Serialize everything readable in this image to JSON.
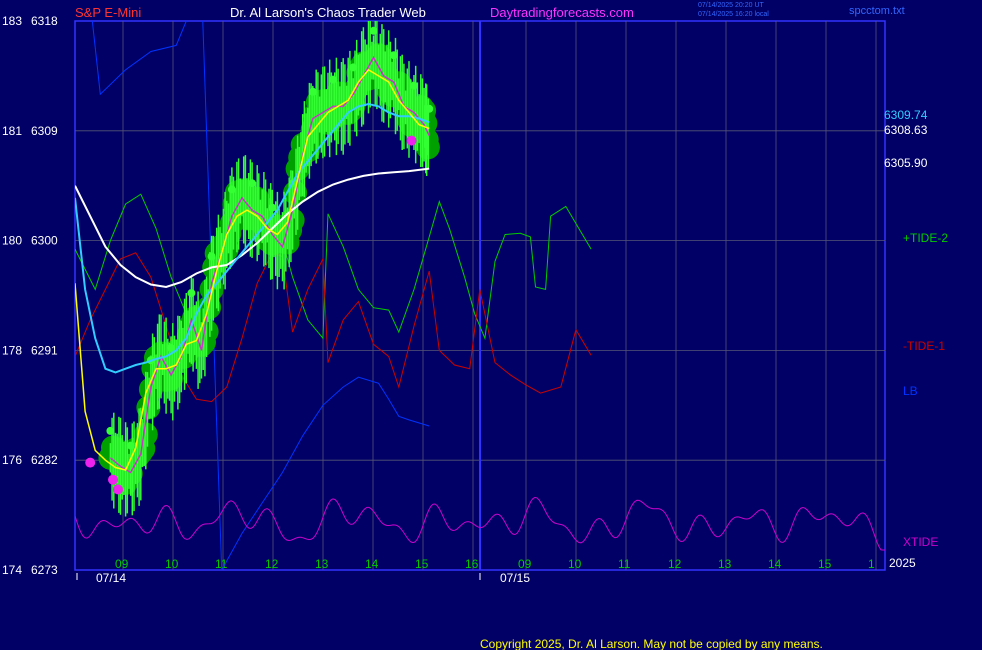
{
  "header": {
    "instrument": "S&P E-Mini",
    "title": "Dr. Al Larson's Chaos Trader Web",
    "site": "Daytradingforecasts.com",
    "timestamp_utc": "07/14/2025 20:20 UT",
    "timestamp_local": "07/14/2025 16:20 local",
    "file": "spcctom.txt"
  },
  "colors": {
    "background": "#000066",
    "plot_border": "#3333ff",
    "grid": "#555577",
    "price_hl": "#00e000",
    "halo": "#00a000",
    "price_close": "#cc33cc",
    "ma_fast": "#ffff00",
    "ma_mid": "#33ccff",
    "ma_slow": "#ffffff",
    "tide_plus": "#00cc00",
    "tide_minus": "#cc0000",
    "lb": "#0033ff",
    "xtide": "#cc00cc",
    "hour_label": "#00cc00",
    "date_label": "#ffffff"
  },
  "chart_data": {
    "type": "line",
    "y_axis": {
      "ticks": [
        {
          "left": "183",
          "price": "6318",
          "value": 6318
        },
        {
          "left": "181",
          "price": "6309",
          "value": 6309
        },
        {
          "left": "180",
          "price": "6300",
          "value": 6300
        },
        {
          "left": "178",
          "price": "6291",
          "value": 6291
        },
        {
          "left": "176",
          "price": "6282",
          "value": 6282
        },
        {
          "left": "174",
          "price": "6273",
          "value": 6273
        }
      ],
      "ylim": [
        6273,
        6318
      ]
    },
    "x_axis": {
      "hour_labels_day1": [
        "09",
        "10",
        "11",
        "12",
        "13",
        "14",
        "15",
        "16"
      ],
      "hour_labels_day2": [
        "09",
        "10",
        "11",
        "12",
        "13",
        "14",
        "15",
        "1"
      ],
      "dates": [
        "07/14",
        "07/15"
      ],
      "year_label": "2025"
    },
    "price_labels": [
      "6309.74",
      "6308.63",
      "6305.90"
    ],
    "series_labels": [
      "+TIDE-2",
      "-TIDE-1",
      "LB",
      "XTIDE"
    ],
    "close": [
      [
        8.7,
        6282.2
      ],
      [
        8.9,
        6281.5
      ],
      [
        9.1,
        6281.0
      ],
      [
        9.3,
        6282.5
      ],
      [
        9.5,
        6288.0
      ],
      [
        9.7,
        6290.5
      ],
      [
        9.9,
        6289.0
      ],
      [
        10.1,
        6290.5
      ],
      [
        10.3,
        6293.5
      ],
      [
        10.5,
        6291.0
      ],
      [
        10.7,
        6296.5
      ],
      [
        10.9,
        6299.0
      ],
      [
        11.1,
        6302.0
      ],
      [
        11.3,
        6303.5
      ],
      [
        11.5,
        6302.5
      ],
      [
        11.7,
        6302.0
      ],
      [
        11.9,
        6300.5
      ],
      [
        12.1,
        6299.5
      ],
      [
        12.3,
        6302.5
      ],
      [
        12.5,
        6307.0
      ],
      [
        12.7,
        6310.0
      ],
      [
        12.9,
        6310.5
      ],
      [
        13.1,
        6311.0
      ],
      [
        13.3,
        6311.0
      ],
      [
        13.5,
        6312.0
      ],
      [
        13.7,
        6313.5
      ],
      [
        13.9,
        6315.0
      ],
      [
        14.1,
        6313.5
      ],
      [
        14.3,
        6313.0
      ],
      [
        14.5,
        6311.0
      ],
      [
        14.7,
        6310.5
      ],
      [
        14.9,
        6309.5
      ],
      [
        15.0,
        6308.6
      ]
    ],
    "ma_fast": [
      [
        8.0,
        6296.5
      ],
      [
        8.2,
        6286.0
      ],
      [
        8.4,
        6282.8
      ],
      [
        8.6,
        6282.0
      ],
      [
        8.8,
        6281.4
      ],
      [
        9.0,
        6281.2
      ],
      [
        9.2,
        6283.0
      ],
      [
        9.4,
        6287.5
      ],
      [
        9.6,
        6289.5
      ],
      [
        9.8,
        6289.5
      ],
      [
        10.0,
        6289.8
      ],
      [
        10.2,
        6291.5
      ],
      [
        10.4,
        6291.8
      ],
      [
        10.6,
        6294.0
      ],
      [
        10.8,
        6297.5
      ],
      [
        11.0,
        6300.5
      ],
      [
        11.2,
        6302.0
      ],
      [
        11.4,
        6302.5
      ],
      [
        11.6,
        6302.0
      ],
      [
        11.8,
        6301.0
      ],
      [
        12.0,
        6300.5
      ],
      [
        12.2,
        6301.5
      ],
      [
        12.4,
        6305.0
      ],
      [
        12.6,
        6308.5
      ],
      [
        12.8,
        6309.5
      ],
      [
        13.0,
        6310.5
      ],
      [
        13.2,
        6311.0
      ],
      [
        13.4,
        6311.5
      ],
      [
        13.6,
        6313.0
      ],
      [
        13.8,
        6314.0
      ],
      [
        14.0,
        6313.5
      ],
      [
        14.2,
        6313.0
      ],
      [
        14.4,
        6311.5
      ],
      [
        14.6,
        6310.5
      ],
      [
        14.8,
        6309.5
      ],
      [
        15.0,
        6309.2
      ]
    ],
    "ma_mid": [
      [
        8.0,
        6303.5
      ],
      [
        8.2,
        6296.0
      ],
      [
        8.4,
        6292.0
      ],
      [
        8.6,
        6289.5
      ],
      [
        8.8,
        6289.2
      ],
      [
        9.0,
        6289.5
      ],
      [
        9.2,
        6289.8
      ],
      [
        9.4,
        6290.0
      ],
      [
        9.6,
        6290.3
      ],
      [
        9.8,
        6290.5
      ],
      [
        10.0,
        6291.0
      ],
      [
        10.2,
        6292.0
      ],
      [
        10.4,
        6294.0
      ],
      [
        10.6,
        6295.5
      ],
      [
        10.8,
        6296.5
      ],
      [
        11.0,
        6297.5
      ],
      [
        11.2,
        6298.5
      ],
      [
        11.4,
        6299.5
      ],
      [
        11.6,
        6300.5
      ],
      [
        11.8,
        6301.5
      ],
      [
        12.0,
        6302.5
      ],
      [
        12.2,
        6304.0
      ],
      [
        12.4,
        6305.5
      ],
      [
        12.6,
        6306.5
      ],
      [
        12.8,
        6307.5
      ],
      [
        13.0,
        6308.5
      ],
      [
        13.2,
        6309.5
      ],
      [
        13.4,
        6310.5
      ],
      [
        13.6,
        6311.0
      ],
      [
        13.8,
        6311.2
      ],
      [
        14.0,
        6311.0
      ],
      [
        14.2,
        6310.5
      ],
      [
        14.4,
        6310.2
      ],
      [
        14.6,
        6310.2
      ],
      [
        14.8,
        6310.0
      ],
      [
        15.0,
        6309.7
      ]
    ],
    "ma_slow": [
      [
        8.0,
        6304.5
      ],
      [
        8.3,
        6302.0
      ],
      [
        8.6,
        6299.5
      ],
      [
        8.9,
        6298.0
      ],
      [
        9.2,
        6297.0
      ],
      [
        9.5,
        6296.4
      ],
      [
        9.8,
        6296.2
      ],
      [
        10.1,
        6296.6
      ],
      [
        10.4,
        6297.3
      ],
      [
        10.7,
        6297.8
      ],
      [
        11.0,
        6298.0
      ],
      [
        11.3,
        6298.8
      ],
      [
        11.6,
        6299.8
      ],
      [
        11.9,
        6301.0
      ],
      [
        12.2,
        6302.2
      ],
      [
        12.5,
        6303.2
      ],
      [
        12.8,
        6304.0
      ],
      [
        13.1,
        6304.6
      ],
      [
        13.4,
        6305.0
      ],
      [
        13.7,
        6305.3
      ],
      [
        14.0,
        6305.5
      ],
      [
        14.3,
        6305.6
      ],
      [
        14.6,
        6305.7
      ],
      [
        15.0,
        6305.9
      ]
    ],
    "tide_plus": [
      [
        8.0,
        6299.3
      ],
      [
        8.4,
        6296.0
      ],
      [
        8.7,
        6300.0
      ],
      [
        9.0,
        6303.0
      ],
      [
        9.3,
        6303.8
      ],
      [
        9.6,
        6301.0
      ],
      [
        9.9,
        6297.0
      ],
      [
        10.2,
        6294.0
      ],
      [
        10.5,
        6293.2
      ],
      [
        10.8,
        6295.0
      ],
      [
        11.1,
        6301.0
      ],
      [
        11.4,
        6304.5
      ],
      [
        11.7,
        6304.0
      ],
      [
        12.0,
        6301.5
      ],
      [
        12.3,
        6297.0
      ],
      [
        12.6,
        6293.5
      ],
      [
        12.9,
        6292.0
      ],
      [
        13.0,
        6302.2
      ],
      [
        13.3,
        6299.5
      ],
      [
        13.6,
        6296.0
      ],
      [
        13.9,
        6294.5
      ],
      [
        14.2,
        6294.3
      ],
      [
        14.4,
        6292.5
      ],
      [
        14.7,
        6296.0
      ],
      [
        15.0,
        6300.3
      ],
      [
        15.2,
        6303.2
      ],
      [
        15.4,
        6301.0
      ],
      [
        15.7,
        6297.0
      ],
      [
        15.9,
        6294.0
      ],
      [
        16.1,
        6292.0
      ],
      [
        16.3,
        6298.3
      ],
      [
        16.5,
        6300.5
      ],
      [
        16.8,
        6300.6
      ],
      [
        17.0,
        6300.3
      ],
      [
        17.1,
        6296.2
      ],
      [
        17.3,
        6296.0
      ],
      [
        17.4,
        6302.0
      ],
      [
        17.7,
        6302.8
      ],
      [
        18.0,
        6300.7
      ],
      [
        18.2,
        6299.3
      ]
    ],
    "tide_minus": [
      [
        8.0,
        6290.5
      ],
      [
        8.3,
        6293.5
      ],
      [
        8.6,
        6296.0
      ],
      [
        8.9,
        6298.5
      ],
      [
        9.2,
        6299.0
      ],
      [
        9.5,
        6297.0
      ],
      [
        9.8,
        6293.0
      ],
      [
        10.1,
        6289.0
      ],
      [
        10.4,
        6287.0
      ],
      [
        10.7,
        6286.8
      ],
      [
        11.0,
        6288.0
      ],
      [
        11.3,
        6292.0
      ],
      [
        11.6,
        6296.5
      ],
      [
        11.9,
        6299.0
      ],
      [
        12.1,
        6298.7
      ],
      [
        12.3,
        6292.5
      ],
      [
        12.6,
        6296.0
      ],
      [
        12.9,
        6298.5
      ],
      [
        13.0,
        6290.0
      ],
      [
        13.3,
        6293.5
      ],
      [
        13.6,
        6295.0
      ],
      [
        13.9,
        6291.5
      ],
      [
        14.2,
        6290.5
      ],
      [
        14.4,
        6288.0
      ],
      [
        14.7,
        6293.0
      ],
      [
        15.0,
        6297.5
      ],
      [
        15.2,
        6291.0
      ],
      [
        15.5,
        6289.8
      ],
      [
        15.8,
        6289.5
      ],
      [
        16.0,
        6296.0
      ],
      [
        16.3,
        6290.0
      ],
      [
        16.6,
        6289.0
      ],
      [
        16.9,
        6288.2
      ],
      [
        17.2,
        6287.5
      ],
      [
        17.6,
        6288.0
      ],
      [
        17.9,
        6292.7
      ],
      [
        18.2,
        6290.6
      ]
    ],
    "lb": [
      [
        8.0,
        6331.0
      ],
      [
        8.5,
        6312.0
      ],
      [
        9.0,
        6314.0
      ],
      [
        9.5,
        6315.5
      ],
      [
        10.0,
        6316.0
      ],
      [
        10.5,
        6321.0
      ],
      [
        10.9,
        6273.0
      ],
      [
        11.3,
        6276.0
      ],
      [
        11.7,
        6278.5
      ],
      [
        12.1,
        6281.0
      ],
      [
        12.5,
        6284.0
      ],
      [
        12.9,
        6286.5
      ],
      [
        13.3,
        6288.0
      ],
      [
        13.6,
        6288.8
      ],
      [
        14.0,
        6288.3
      ],
      [
        14.2,
        6287.0
      ],
      [
        14.4,
        6285.6
      ],
      [
        14.6,
        6285.3
      ],
      [
        15.0,
        6284.8
      ]
    ],
    "xtide_segments": [
      [
        0,
        22
      ],
      [
        1,
        22
      ]
    ]
  },
  "footer": {
    "copyright": "Copyright 2025, Dr. Al Larson. May not be copied by any means."
  }
}
